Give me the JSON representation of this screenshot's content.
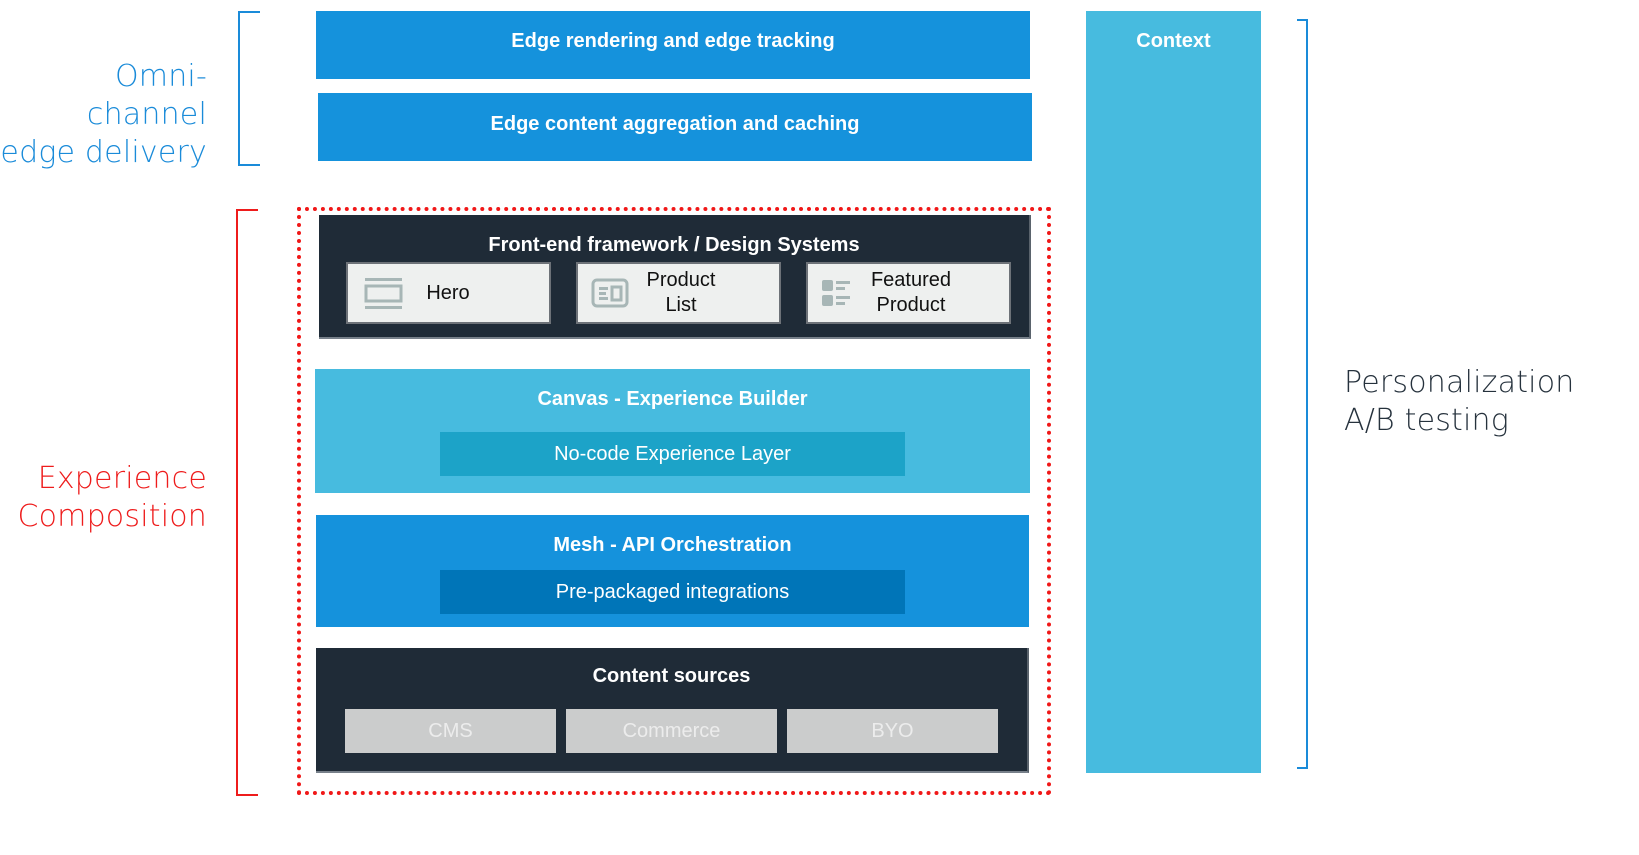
{
  "groups": {
    "edge": {
      "label_line1": "Omni-channel",
      "label_line2": "edge delivery",
      "color": "#1a8bd9"
    },
    "composition": {
      "label_line1": "Experience",
      "label_line2": "Composition",
      "color": "#ee1c1c"
    },
    "personalization": {
      "label_line1": "Personalization",
      "label_line2": "A/B testing",
      "color": "#26323d"
    }
  },
  "edge_layers": [
    {
      "title": "Edge rendering and edge tracking"
    },
    {
      "title": "Edge content aggregation and caching"
    }
  ],
  "context_column": {
    "title": "Context"
  },
  "frontend": {
    "title": "Front-end framework / Design Systems",
    "components": [
      {
        "label_line1": "Hero",
        "label_line2": "",
        "icon": "hero-banner-icon"
      },
      {
        "label_line1": "Product",
        "label_line2": "List",
        "icon": "product-list-icon"
      },
      {
        "label_line1": "Featured",
        "label_line2": "Product",
        "icon": "featured-product-icon"
      }
    ]
  },
  "canvas": {
    "title": "Canvas - Experience Builder",
    "sublayer": "No-code Experience Layer"
  },
  "mesh": {
    "title": "Mesh - API Orchestration",
    "sublayer": "Pre-packaged integrations"
  },
  "content_sources": {
    "title": "Content sources",
    "items": [
      "CMS",
      "Commerce",
      "BYO"
    ]
  },
  "colors": {
    "edge_blue": "#1592dc",
    "light_blue": "#47bbdf",
    "dark_navy": "#1f2b37",
    "teal_inner": "#1ca3c8",
    "navy_inner": "#0075b8",
    "red_frame": "#f01818"
  }
}
